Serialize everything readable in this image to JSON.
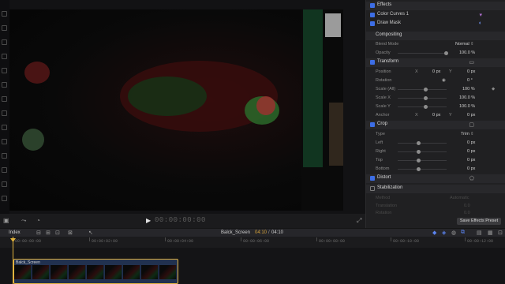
{
  "inspector": {
    "effects_header": "Effects",
    "color_curves_label": "Color Curves 1",
    "draw_mask_label": "Draw Mask",
    "compositing_label": "Compositing",
    "blend_mode_label": "Blend Mode",
    "blend_mode_value": "Normal",
    "opacity_label": "Opacity",
    "opacity_value": "100.0 %",
    "transform_header": "Transform",
    "position_label": "Position",
    "position_x_label": "X",
    "position_x_value": "0 px",
    "position_y_label": "Y",
    "position_y_value": "0 px",
    "rotation_label": "Rotation",
    "rotation_value": "0 °",
    "scale_all_label": "Scale (All)",
    "scale_all_value": "100 %",
    "scale_x_label": "Scale X",
    "scale_x_value": "100.0 %",
    "scale_y_label": "Scale Y",
    "scale_y_value": "100.0 %",
    "anchor_label": "Anchor",
    "anchor_x_label": "X",
    "anchor_x_value": "0 px",
    "anchor_y_label": "Y",
    "anchor_y_value": "0 px",
    "crop_header": "Crop",
    "type_label": "Type",
    "type_value": "Trim",
    "left_label": "Left",
    "left_value": "0 px",
    "right_label": "Right",
    "right_value": "0 px",
    "top_label": "Top",
    "top_value": "0 px",
    "bottom_label": "Bottom",
    "bottom_value": "0 px",
    "distort_header": "Distort",
    "stabilization_header": "Stabilization",
    "stab_method_label": "Method",
    "stab_method_value": "Automatic",
    "stab_translation_label": "Translation",
    "stab_translation_value": "0.0",
    "stab_rotation_label": "Rotation",
    "stab_rotation_value": "0.0",
    "save_preset_label": "Save Effects Preset"
  },
  "viewer": {
    "timecode": "00:00:00:00"
  },
  "timeline": {
    "index_label": "Index",
    "project_name": "Balck_Screen",
    "current_time": "04:10",
    "separator": "/",
    "duration": "04:10",
    "clip_name": "Balck_Screen",
    "ruler_labels": [
      "00:00:00:00",
      "00:00:02:00",
      "00:00:04:00",
      "00:00:06:00",
      "00:00:08:00",
      "00:00:10:00",
      "00:00:12:00"
    ]
  },
  "colors": {
    "accent_blue": "#3d6ee6",
    "playhead": "#e0b23c",
    "clip_fill": "#21314f"
  }
}
